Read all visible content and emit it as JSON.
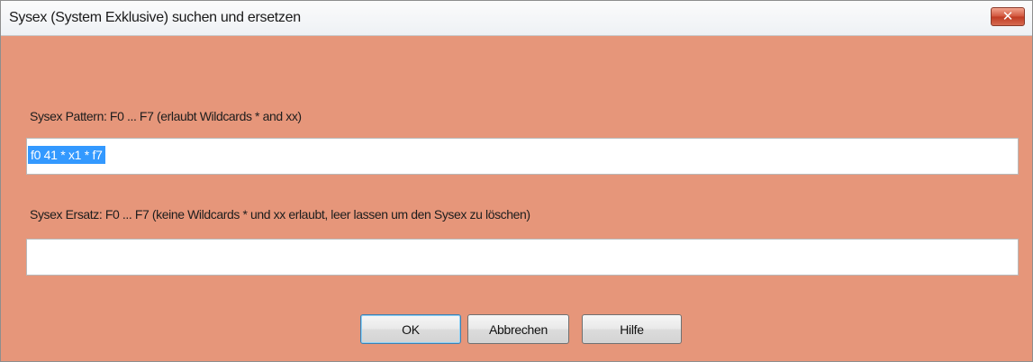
{
  "window": {
    "title": "Sysex (System Exklusive) suchen und ersetzen",
    "close_glyph": "✕",
    "close_icon": "close-icon",
    "background_color": "#e6967a",
    "close_button_color": "#c7462c"
  },
  "pattern": {
    "label": "Sysex Pattern:  F0 ... F7 (erlaubt Wildcards * and xx)",
    "value": "f0 41 * x1 * f7"
  },
  "replacement": {
    "label": "Sysex Ersatz: F0 ... F7 (keine Wildcards * und xx erlaubt, leer lassen um den Sysex zu löschen)",
    "value": ""
  },
  "buttons": {
    "ok": "OK",
    "cancel": "Abbrechen",
    "help": "Hilfe"
  }
}
